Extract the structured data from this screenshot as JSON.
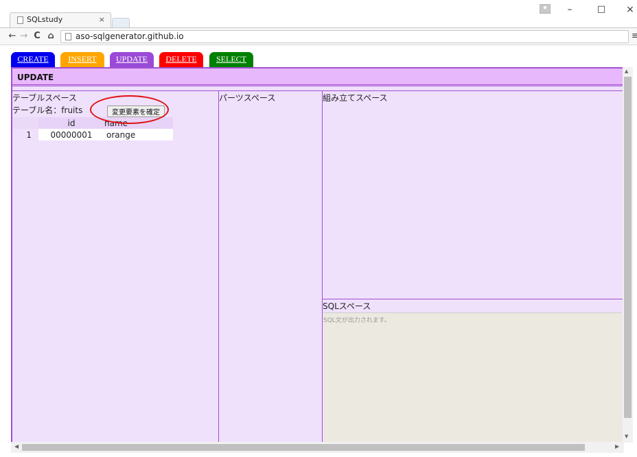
{
  "browser": {
    "tab_title": "SQLstudy",
    "tab_close": "×",
    "url": "aso-sqlgenerator.github.io",
    "nav": {
      "back": "←",
      "forward": "→",
      "reload": "C",
      "home": "⌂",
      "menu": "≡"
    },
    "window": {
      "minimize": "–",
      "maximize": "□",
      "close": "×"
    }
  },
  "optabs": [
    {
      "label": "CREATE",
      "color": "#0000ee"
    },
    {
      "label": "INSERT",
      "color": "#ffa500"
    },
    {
      "label": "UPDATE",
      "color": "#9a4ad6"
    },
    {
      "label": "DELETE",
      "color": "#ff0000"
    },
    {
      "label": "SELECT",
      "color": "#008000"
    }
  ],
  "header": {
    "title": "UPDATE"
  },
  "table_space": {
    "label": "テーブルスペース",
    "table_name_label": "テーブル名：fruits",
    "confirm_button": "変更要素を確定",
    "columns": [
      "",
      "id",
      "name"
    ],
    "rows": [
      {
        "num": "1",
        "id": "00000001",
        "name": "orange"
      }
    ]
  },
  "parts_space": {
    "label": "パーツスペース"
  },
  "build_space": {
    "label": "組み立てスペース"
  },
  "sql_space": {
    "label": "SQLスペース",
    "placeholder": "SQL文が出力されます。"
  },
  "colors": {
    "frame_border": "#a04fd0",
    "panel_bg": "#efe0fb",
    "header_bg": "#e8b8fc",
    "highlight": "#e01010"
  }
}
